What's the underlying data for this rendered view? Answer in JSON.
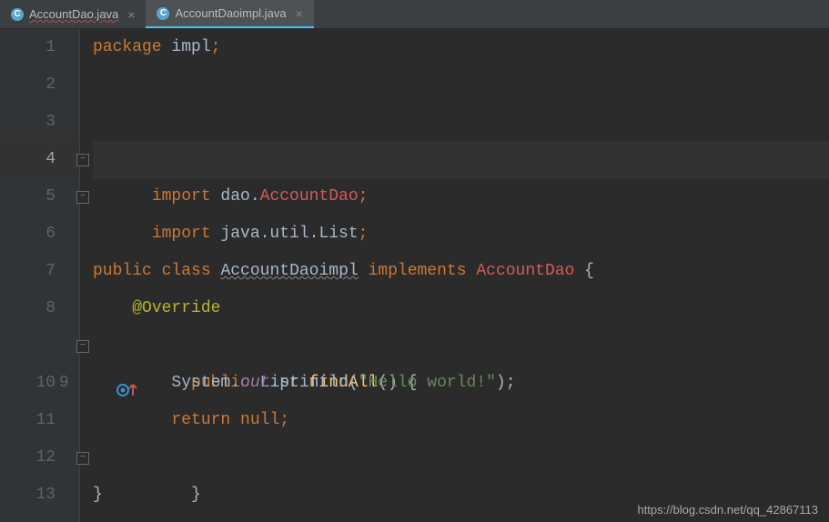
{
  "tabs": [
    {
      "label": "AccountDao.java",
      "active": false,
      "squiggle": true
    },
    {
      "label": "AccountDaoimpl.java",
      "active": true,
      "squiggle": false
    }
  ],
  "lines": {
    "l1": {
      "num": "1",
      "t1": "package",
      "t2": " impl",
      "t3": ";"
    },
    "l2": {
      "num": "2"
    },
    "l3": {
      "num": "3"
    },
    "l4": {
      "num": "4",
      "t1": "import",
      "t2": " dao.",
      "t3": "AccountDao",
      "t4": ";"
    },
    "l5": {
      "num": "5",
      "t1": "import",
      "t2": " java.util.List",
      "t3": ";"
    },
    "l6": {
      "num": "6"
    },
    "l7": {
      "num": "7",
      "t1": "public",
      "t2": " ",
      "t3": "class",
      "t4": " ",
      "t5": "AccountDaoimpl",
      "t6": " ",
      "t7": "implements",
      "t8": " ",
      "t9": "AccountDao",
      "t10": " {"
    },
    "l8": {
      "num": "8",
      "indent": "    ",
      "t1": "@Override"
    },
    "l9": {
      "num": "9",
      "indent": "    ",
      "t1": "public",
      "t2": " List ",
      "t3": "findAll",
      "t4": "() {"
    },
    "l10": {
      "num": "10",
      "indent": "        ",
      "t1": "System.",
      "t2": "out",
      "t3": ".println(",
      "t4": "\"Hello world!\"",
      "t5": ");"
    },
    "l11": {
      "num": "11",
      "indent": "        ",
      "t1": "return",
      "t2": " ",
      "t3": "null",
      "t4": ";"
    },
    "l12": {
      "num": "12",
      "indent": "    ",
      "t1": "}"
    },
    "l13": {
      "num": "13",
      "t1": "}"
    }
  },
  "watermark": "https://blog.csdn.net/qq_42867113"
}
